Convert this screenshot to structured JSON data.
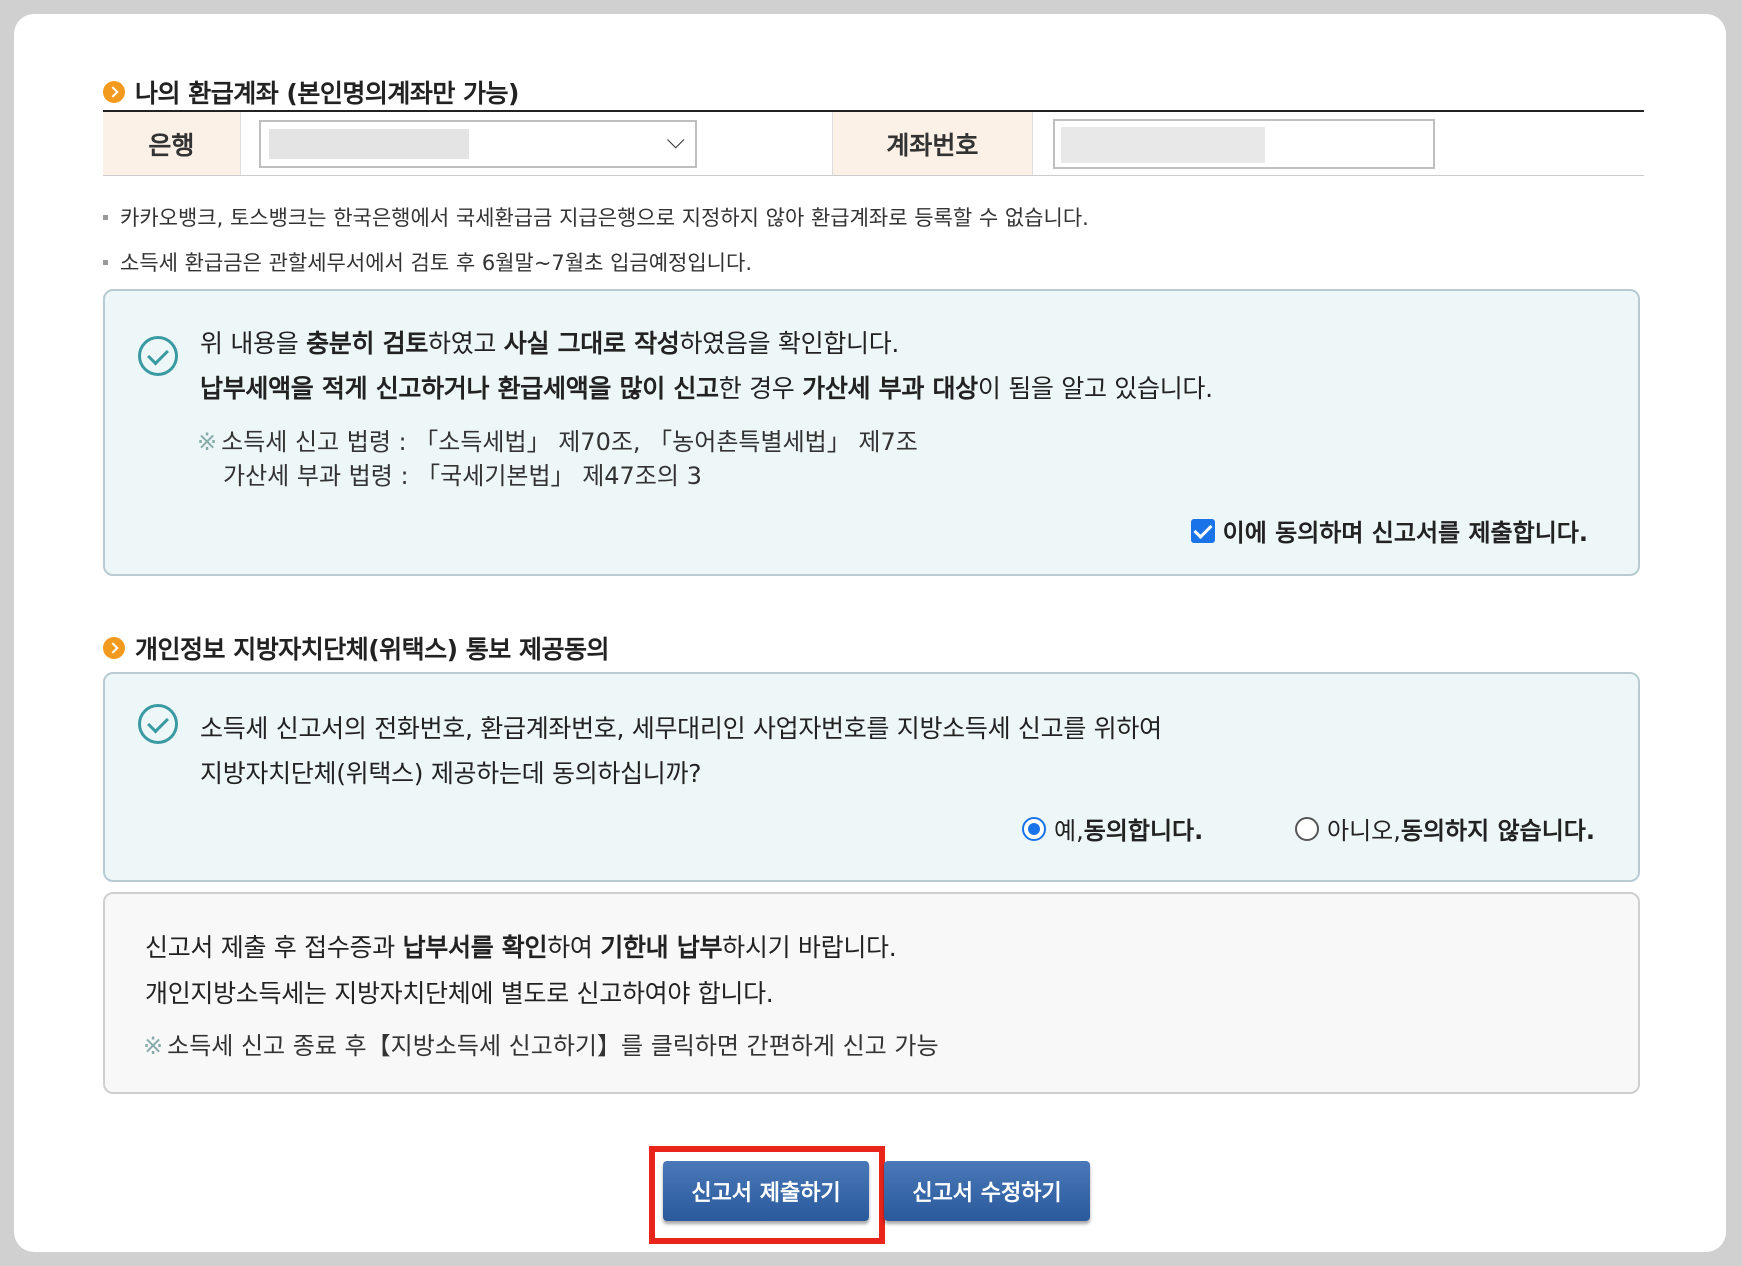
{
  "refund_account": {
    "title": "나의 환급계좌 (본인명의계좌만 가능)",
    "bank_label": "은행",
    "account_label": "계좌번호",
    "notes": [
      "카카오뱅크, 토스뱅크는 한국은행에서 국세환급금 지급은행으로 지정하지 않아 환급계좌로 등록할 수 없습니다.",
      "소득세 환급금은 관할세무서에서 검토 후 6월말~7월초 입금예정입니다."
    ]
  },
  "confirm_box": {
    "line1": {
      "p1": "위 내용을 ",
      "b1": "충분히 검토",
      "p2": "하였고 ",
      "b2": "사실 그대로 작성",
      "p3": "하였음을 확인합니다."
    },
    "line2": {
      "b1": "납부세액을 적게 신고하거나 환급세액을 많이 신고",
      "p1": "한 경우 ",
      "b2": "가산세 부과 대상",
      "p2": "이 됨을 알고 있습니다."
    },
    "law1": "소득세 신고 법령 : 「소득세법」 제70조, 「농어촌특별세법」 제7조",
    "law2": "가산세 부과 법령 : 「국세기본법」 제47조의 3",
    "law_mark": "※",
    "agree_label": "이에 동의하며 신고서를 제출합니다.",
    "agree_checked": true
  },
  "privacy": {
    "title": "개인정보 지방자치단체(위택스) 통보 제공동의",
    "line1": "소득세 신고서의 전화번호, 환급계좌번호, 세무대리인 사업자번호를 지방소득세 신고를 위하여",
    "line2": "지방자치단체(위택스) 제공하는데 동의하십니까?",
    "yes": {
      "prefix": "예, ",
      "bold": "동의합니다."
    },
    "no": {
      "prefix": "아니오, ",
      "bold": "동의하지 않습니다."
    },
    "selected": "yes"
  },
  "info_box": {
    "line1": {
      "p1": "신고서 제출 후 접수증과 ",
      "b1": "납부서를 확인",
      "p2": "하여 ",
      "b2": "기한내 납부",
      "p3": "하시기 바랍니다."
    },
    "line2": "개인지방소득세는 지방자치단체에 별도로 신고하여야 합니다.",
    "mark": "※",
    "line3": "소득세 신고 종료 후【지방소득세 신고하기】를 클릭하면 간편하게 신고 가능"
  },
  "buttons": {
    "submit": "신고서 제출하기",
    "edit": "신고서 수정하기"
  },
  "colors": {
    "accent_orange": "#f29a1d",
    "button_blue": "#2a5a9c",
    "highlight_red": "#e8241b",
    "check_teal": "#3a9aa2"
  }
}
